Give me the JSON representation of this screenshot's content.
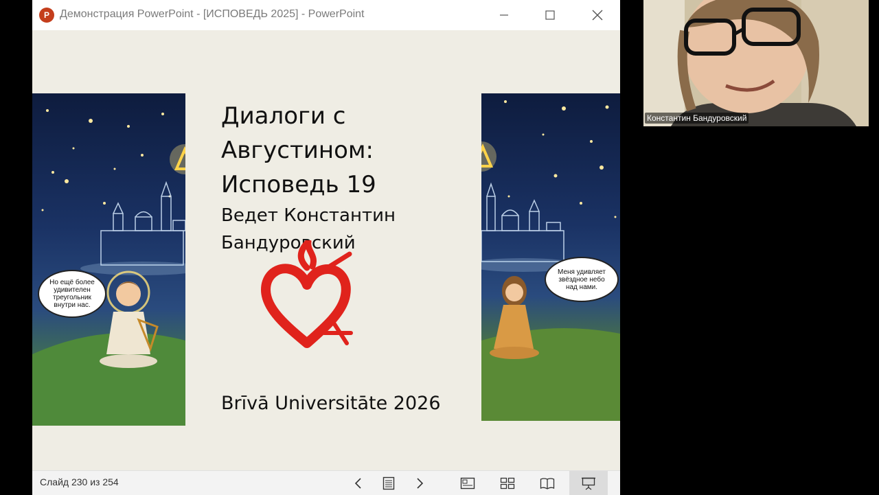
{
  "window": {
    "title": "Демонстрация PowerPoint - [ИСПОВЕДЬ 2025] - PowerPoint",
    "app_icon_letter": "P",
    "app_icon_color": "#c43e1c"
  },
  "slide": {
    "title_lines": [
      "Диалоги с",
      "Августином:",
      "Исповедь 19"
    ],
    "subtitle_lines": [
      "Ведет Константин",
      "Бандуровский"
    ],
    "footer": "Brīvā Universitāte 2026",
    "logo_color": "#e0231c",
    "left_image": {
      "bubble_lines": [
        "Но ещё более",
        "удивителен",
        "треугольник",
        "внутри нас."
      ]
    },
    "right_image": {
      "bubble_lines": [
        "Меня удивляет",
        "звёздное небо",
        "над нами."
      ]
    }
  },
  "statusbar": {
    "slide_counter": "Слайд 230 из 254"
  },
  "video": {
    "participant_name": "Константин Бандуровский"
  }
}
